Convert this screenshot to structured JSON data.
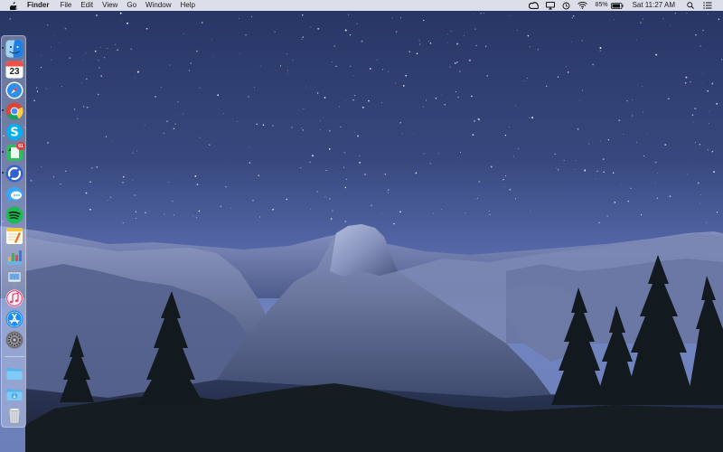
{
  "menu_bar": {
    "apple_icon": "apple-logo-icon",
    "app_name": "Finder",
    "menus": [
      "File",
      "Edit",
      "View",
      "Go",
      "Window",
      "Help"
    ],
    "status_icons": [
      "creative-cloud-icon",
      "airplay-icon",
      "time-machine-icon",
      "wifi-icon"
    ],
    "battery_percent": "85%",
    "clock": "Sat 11:27 AM",
    "right_icons": [
      "spotlight-icon",
      "notification-center-icon"
    ]
  },
  "dock": {
    "position": "left",
    "apps": [
      {
        "name": "Finder",
        "icon": "finder-icon",
        "running": true
      },
      {
        "name": "Calendar",
        "icon": "calendar-icon",
        "date": "23",
        "running": false
      },
      {
        "name": "Safari",
        "icon": "safari-icon",
        "running": false
      },
      {
        "name": "Google Chrome",
        "icon": "chrome-icon",
        "running": true
      },
      {
        "name": "Skype",
        "icon": "skype-icon",
        "running": false
      },
      {
        "name": "Evernote",
        "icon": "evernote-icon",
        "badge": "61",
        "running": true
      },
      {
        "name": "Simplenote",
        "icon": "simplenote-icon",
        "running": true
      },
      {
        "name": "Messages",
        "icon": "messages-icon",
        "running": false
      },
      {
        "name": "Spotify",
        "icon": "spotify-icon",
        "running": false
      },
      {
        "name": "Notes",
        "icon": "notes-icon",
        "running": false
      },
      {
        "name": "Numbers",
        "icon": "numbers-icon",
        "running": false
      },
      {
        "name": "Preview",
        "icon": "preview-icon",
        "running": false
      },
      {
        "name": "iTunes",
        "icon": "itunes-icon",
        "running": false
      },
      {
        "name": "App Store",
        "icon": "app-store-icon",
        "running": false
      },
      {
        "name": "System Preferences",
        "icon": "system-preferences-icon",
        "running": false
      }
    ],
    "stacks": [
      {
        "name": "Applications folder",
        "icon": "folder-icon"
      },
      {
        "name": "Downloads",
        "icon": "downloads-folder-icon"
      },
      {
        "name": "Trash",
        "icon": "trash-icon"
      }
    ]
  },
  "desktop": {
    "wallpaper": "Yosemite Half Dome at night",
    "colors": {
      "sky_top": "#2b3a6a",
      "sky_bottom": "#6276b8",
      "mountains": "#7e8db7",
      "trees": "#141c22"
    }
  }
}
